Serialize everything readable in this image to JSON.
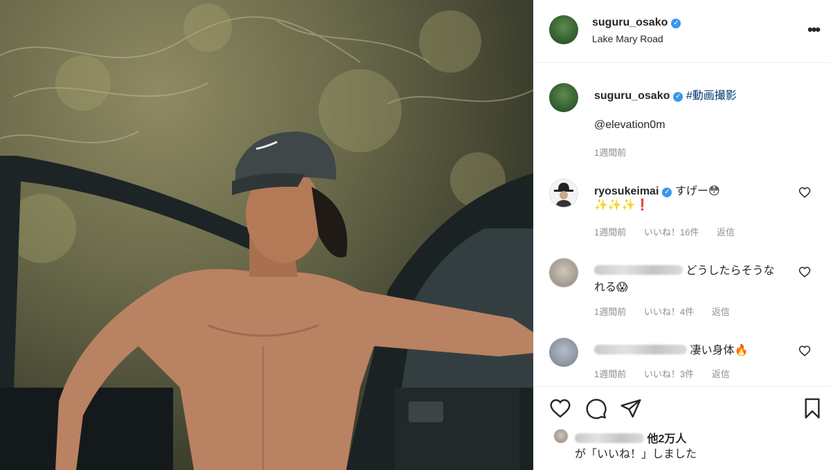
{
  "post": {
    "username": "suguru_osako",
    "location": "Lake Mary Road",
    "caption_tag": "#動画撮影",
    "caption_mention": "@elevation0m",
    "time": "1週間前"
  },
  "comments": [
    {
      "username": "ryosukeimai",
      "text": "すげー😳",
      "text2": "✨✨✨❗",
      "time": "1週間前",
      "likes": "いいね！16件",
      "reply": "返信"
    },
    {
      "username": "",
      "text": "どうしたらそうな",
      "text2": "れる😱",
      "time": "1週間前",
      "likes": "いいね！4件",
      "reply": "返信"
    },
    {
      "username": "",
      "text": "凄い身体🔥",
      "time": "1週間前",
      "likes": "いいね！3件",
      "reply": "返信"
    }
  ],
  "likes_summary": {
    "others": "他2万人",
    "suffix": "が「いいね！」しました"
  },
  "colors": {
    "link": "#00376b",
    "verified": "#3897f0",
    "meta": "#8e8e8e"
  },
  "icons": [
    "heart-icon",
    "comment-icon",
    "share-icon",
    "bookmark-icon",
    "more-icon",
    "verified-icon"
  ]
}
